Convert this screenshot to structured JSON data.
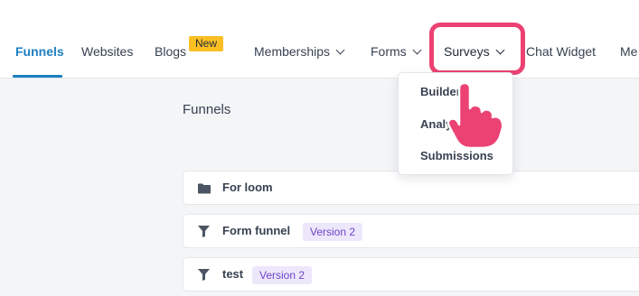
{
  "nav": {
    "items": [
      {
        "label": "Funnels",
        "active": true
      },
      {
        "label": "Websites"
      },
      {
        "label": "Blogs",
        "badge": "New"
      },
      {
        "label": "Memberships",
        "dropdown": true
      },
      {
        "label": "Forms",
        "dropdown": true
      },
      {
        "label": "Surveys",
        "dropdown": true,
        "highlighted": true
      },
      {
        "label": "Chat Widget"
      },
      {
        "label": "Me"
      }
    ]
  },
  "dropdown": {
    "items": [
      "Builder",
      "Analy",
      "Submissions"
    ]
  },
  "main": {
    "heading": "Funnels",
    "rows": [
      {
        "icon": "folder-icon",
        "name": "For loom"
      },
      {
        "icon": "funnel-icon",
        "name": "Form funnel",
        "badge": "Version 2"
      },
      {
        "icon": "funnel-icon",
        "name": "test",
        "badge": "Version 2"
      }
    ]
  },
  "colors": {
    "accent": "#1d7fc1",
    "highlight": "#ec4273",
    "new_badge": "#fbbf24",
    "version_badge_bg": "#ede7fb",
    "version_badge_text": "#6d43c9"
  }
}
